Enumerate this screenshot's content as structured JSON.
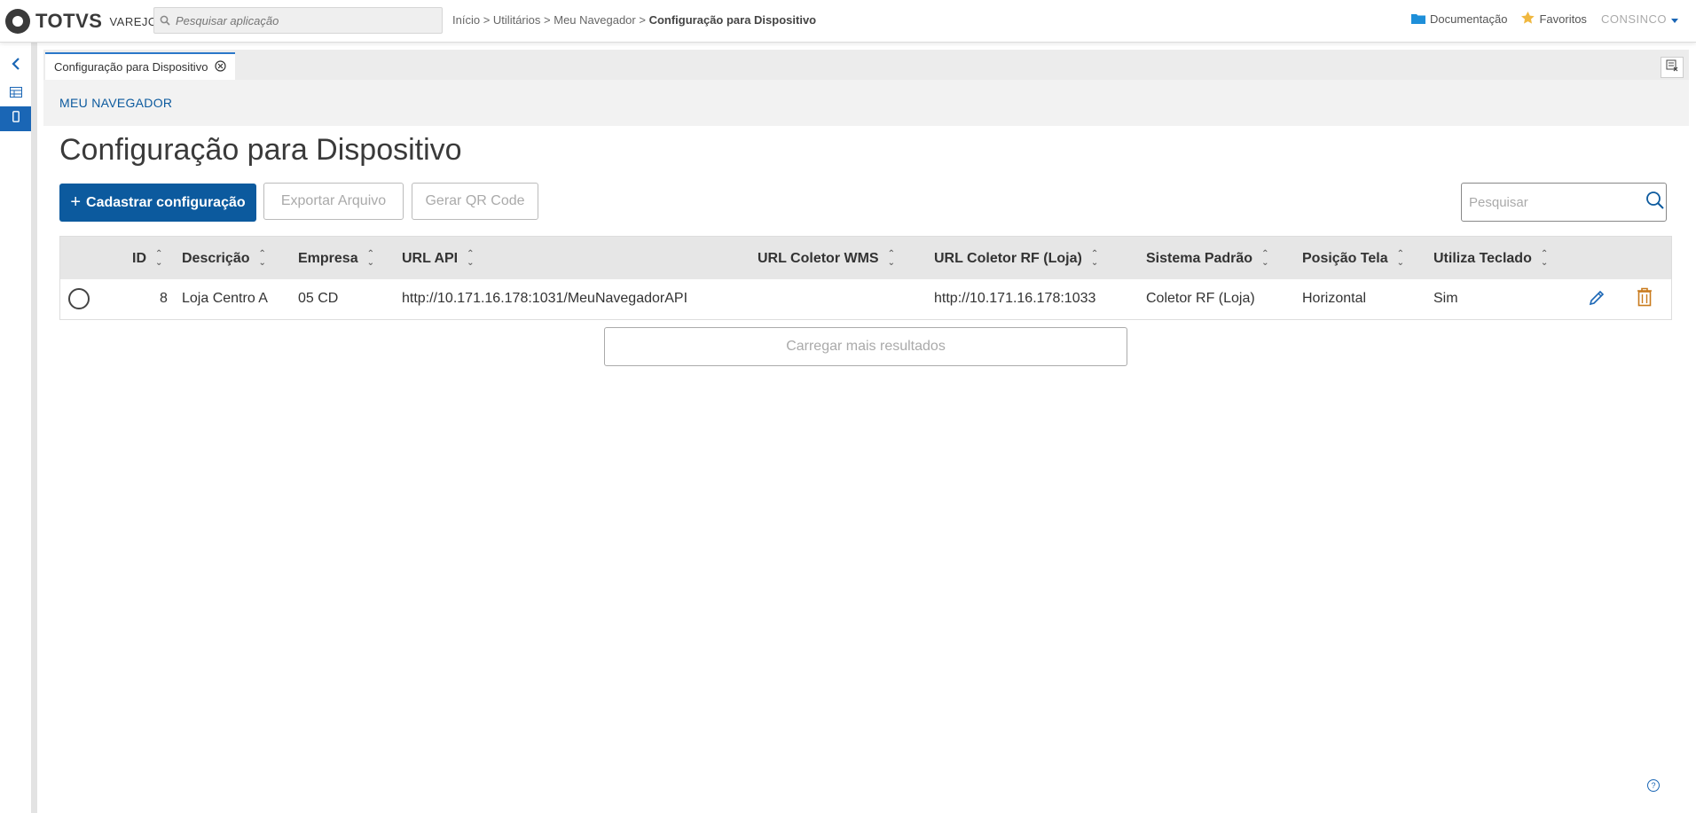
{
  "brand": {
    "name": "TOTVS",
    "sub": "VAREJO"
  },
  "app_search": {
    "placeholder": "Pesquisar aplicação"
  },
  "breadcrumb": {
    "items": [
      "Início",
      "Utilitários",
      "Meu Navegador"
    ],
    "separator": ">",
    "current": "Configuração para Dispositivo"
  },
  "top_nav": {
    "documentation": "Documentação",
    "favorites": "Favoritos",
    "user": "CONSINCO"
  },
  "tab": {
    "label": "Configuração para Dispositivo"
  },
  "section": {
    "label": "MEU NAVEGADOR"
  },
  "page": {
    "title": "Configuração para Dispositivo"
  },
  "toolbar": {
    "add_label": "Cadastrar configuração",
    "add_plus": "+",
    "export_label": "Exportar Arquivo",
    "qr_label": "Gerar QR Code",
    "search_placeholder": "Pesquisar"
  },
  "table": {
    "columns": [
      "ID",
      "Descrição",
      "Empresa",
      "URL API",
      "URL Coletor WMS",
      "URL Coletor RF (Loja)",
      "Sistema Padrão",
      "Posição Tela",
      "Utiliza Teclado"
    ],
    "rows": [
      {
        "id": "8",
        "descricao": "Loja Centro A",
        "empresa": "05 CD",
        "url_api": "http://10.171.16.178:1031/MeuNavegadorAPI",
        "url_coletor_wms": "",
        "url_coletor_rf": "http://10.171.16.178:1033",
        "sistema_padrao": "Coletor RF (Loja)",
        "posicao_tela": "Horizontal",
        "utiliza_teclado": "Sim"
      }
    ]
  },
  "load_more": {
    "label": "Carregar mais resultados"
  },
  "help": {
    "label": "?"
  },
  "colors": {
    "primary": "#0c5a9e",
    "accent": "#1a66b5",
    "delete": "#c97a1c"
  }
}
